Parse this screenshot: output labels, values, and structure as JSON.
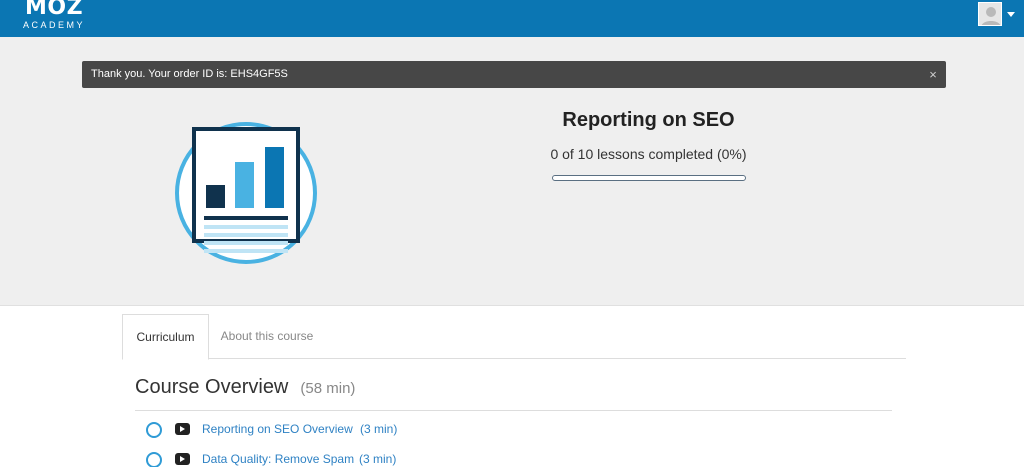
{
  "header": {
    "logo_main": "MOZ",
    "logo_sub": "ACADEMY",
    "brand_color": "#0b76b3"
  },
  "alert": {
    "message": "Thank you. Your order ID is: EHS4GF5S",
    "close_glyph": "×"
  },
  "course": {
    "title": "Reporting on SEO",
    "progress_text": "0 of 10 lessons completed (0%)",
    "progress_fraction": 0,
    "icon": "bar-chart-report-icon"
  },
  "tabs": [
    {
      "label": "Curriculum",
      "active": true
    },
    {
      "label": "About this course",
      "active": false
    }
  ],
  "overview": {
    "title": "Course Overview",
    "duration": "(58 min)"
  },
  "lessons": [
    {
      "title": "Reporting on SEO Overview",
      "duration": "(3 min)",
      "icon": "video-icon"
    },
    {
      "title": "Data Quality: Remove Spam",
      "duration": "(3 min)",
      "icon": "video-icon"
    }
  ]
}
